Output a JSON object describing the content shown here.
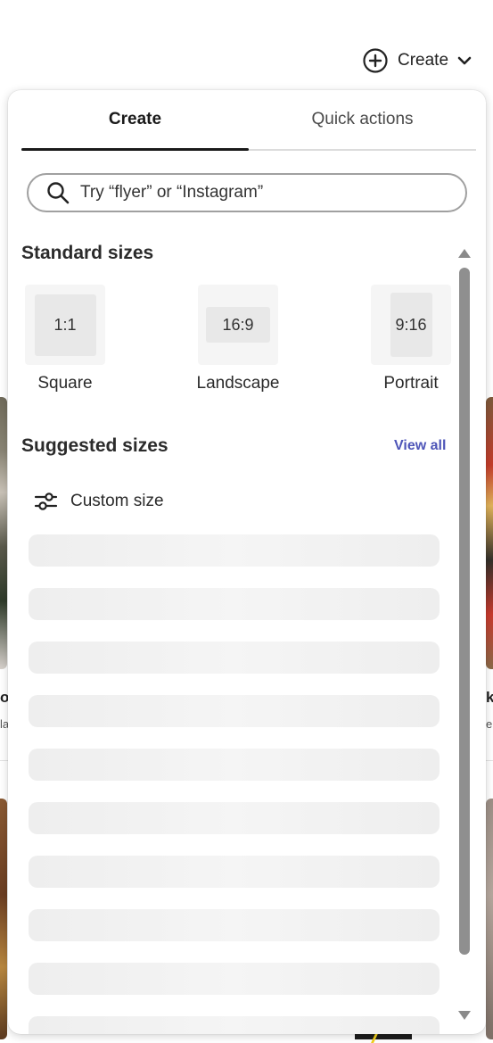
{
  "header": {
    "create_label": "Create"
  },
  "popover": {
    "tabs": [
      {
        "label": "Create",
        "active": true
      },
      {
        "label": "Quick actions",
        "active": false
      }
    ],
    "search": {
      "placeholder": "Try “flyer” or “Instagram”",
      "value": ""
    },
    "standard_sizes": {
      "title": "Standard sizes",
      "items": [
        {
          "ratio": "1:1",
          "label": "Square"
        },
        {
          "ratio": "16:9",
          "label": "Landscape"
        },
        {
          "ratio": "9:16",
          "label": "Portrait"
        }
      ]
    },
    "suggested_sizes": {
      "title": "Suggested sizes",
      "view_all_label": "View all",
      "custom_size_label": "Custom size",
      "loading_placeholder_count": 10
    }
  },
  "background": {
    "left_text_1": "os",
    "left_text_2": "la",
    "right_text_1": "k",
    "right_text_2": "e"
  },
  "colors": {
    "accent_link": "#4e55b8",
    "active_tab_indicator": "#1a1a1a",
    "skeleton": "#eeeeee",
    "scrollbar": "#8f8f8f"
  },
  "icons": [
    "plus-circle-icon",
    "chevron-down-icon",
    "search-icon",
    "sliders-icon"
  ]
}
